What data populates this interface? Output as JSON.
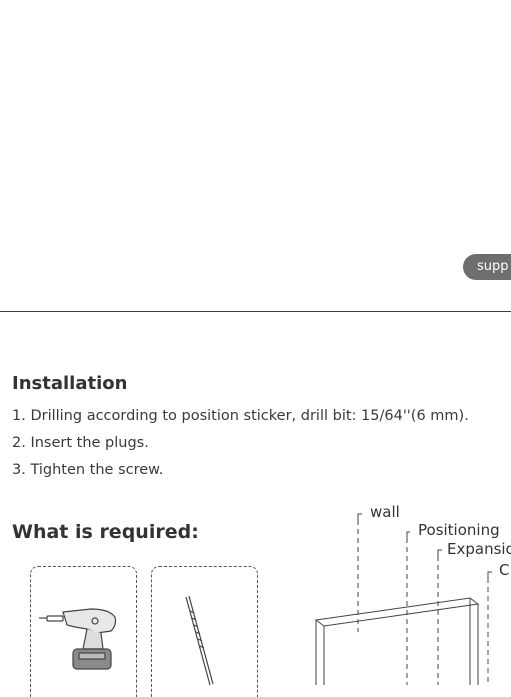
{
  "support_pill": {
    "label": "supp"
  },
  "installation": {
    "heading": "Installation",
    "steps": [
      "1. Drilling according to position sticker, drill bit: 15/64''(6 mm).",
      "2. Insert the plugs.",
      "3. Tighten the screw."
    ]
  },
  "required": {
    "heading": "What is required:",
    "tools": [
      "drill-icon",
      "drill-bit-icon"
    ]
  },
  "diagram": {
    "labels": {
      "wall": "wall",
      "positioning": "Positioning",
      "expansion": "Expansio",
      "c": "C"
    }
  }
}
